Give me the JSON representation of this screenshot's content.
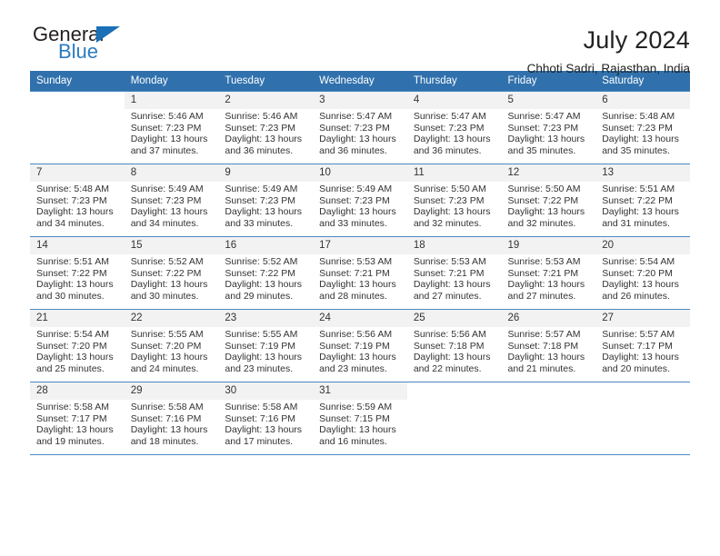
{
  "brand": {
    "name_top": "General",
    "name_bottom": "Blue",
    "triangle_color": "#1b70b8",
    "blue_color": "#2b7cc0"
  },
  "header": {
    "title": "July 2024",
    "location": "Chhoti Sadri, Rajasthan, India"
  },
  "calendar": {
    "header_bg": "#3071ad",
    "weekdays": [
      "Sunday",
      "Monday",
      "Tuesday",
      "Wednesday",
      "Thursday",
      "Friday",
      "Saturday"
    ],
    "labels": {
      "sunrise": "Sunrise:",
      "sunset": "Sunset:",
      "daylight": "Daylight:"
    },
    "weeks": [
      [
        {
          "day": "",
          "sunrise": "",
          "sunset": "",
          "daylight_line1": "",
          "daylight_line2": ""
        },
        {
          "day": "1",
          "sunrise": "Sunrise: 5:46 AM",
          "sunset": "Sunset: 7:23 PM",
          "daylight_line1": "Daylight: 13 hours",
          "daylight_line2": "and 37 minutes."
        },
        {
          "day": "2",
          "sunrise": "Sunrise: 5:46 AM",
          "sunset": "Sunset: 7:23 PM",
          "daylight_line1": "Daylight: 13 hours",
          "daylight_line2": "and 36 minutes."
        },
        {
          "day": "3",
          "sunrise": "Sunrise: 5:47 AM",
          "sunset": "Sunset: 7:23 PM",
          "daylight_line1": "Daylight: 13 hours",
          "daylight_line2": "and 36 minutes."
        },
        {
          "day": "4",
          "sunrise": "Sunrise: 5:47 AM",
          "sunset": "Sunset: 7:23 PM",
          "daylight_line1": "Daylight: 13 hours",
          "daylight_line2": "and 36 minutes."
        },
        {
          "day": "5",
          "sunrise": "Sunrise: 5:47 AM",
          "sunset": "Sunset: 7:23 PM",
          "daylight_line1": "Daylight: 13 hours",
          "daylight_line2": "and 35 minutes."
        },
        {
          "day": "6",
          "sunrise": "Sunrise: 5:48 AM",
          "sunset": "Sunset: 7:23 PM",
          "daylight_line1": "Daylight: 13 hours",
          "daylight_line2": "and 35 minutes."
        }
      ],
      [
        {
          "day": "7",
          "sunrise": "Sunrise: 5:48 AM",
          "sunset": "Sunset: 7:23 PM",
          "daylight_line1": "Daylight: 13 hours",
          "daylight_line2": "and 34 minutes."
        },
        {
          "day": "8",
          "sunrise": "Sunrise: 5:49 AM",
          "sunset": "Sunset: 7:23 PM",
          "daylight_line1": "Daylight: 13 hours",
          "daylight_line2": "and 34 minutes."
        },
        {
          "day": "9",
          "sunrise": "Sunrise: 5:49 AM",
          "sunset": "Sunset: 7:23 PM",
          "daylight_line1": "Daylight: 13 hours",
          "daylight_line2": "and 33 minutes."
        },
        {
          "day": "10",
          "sunrise": "Sunrise: 5:49 AM",
          "sunset": "Sunset: 7:23 PM",
          "daylight_line1": "Daylight: 13 hours",
          "daylight_line2": "and 33 minutes."
        },
        {
          "day": "11",
          "sunrise": "Sunrise: 5:50 AM",
          "sunset": "Sunset: 7:23 PM",
          "daylight_line1": "Daylight: 13 hours",
          "daylight_line2": "and 32 minutes."
        },
        {
          "day": "12",
          "sunrise": "Sunrise: 5:50 AM",
          "sunset": "Sunset: 7:22 PM",
          "daylight_line1": "Daylight: 13 hours",
          "daylight_line2": "and 32 minutes."
        },
        {
          "day": "13",
          "sunrise": "Sunrise: 5:51 AM",
          "sunset": "Sunset: 7:22 PM",
          "daylight_line1": "Daylight: 13 hours",
          "daylight_line2": "and 31 minutes."
        }
      ],
      [
        {
          "day": "14",
          "sunrise": "Sunrise: 5:51 AM",
          "sunset": "Sunset: 7:22 PM",
          "daylight_line1": "Daylight: 13 hours",
          "daylight_line2": "and 30 minutes."
        },
        {
          "day": "15",
          "sunrise": "Sunrise: 5:52 AM",
          "sunset": "Sunset: 7:22 PM",
          "daylight_line1": "Daylight: 13 hours",
          "daylight_line2": "and 30 minutes."
        },
        {
          "day": "16",
          "sunrise": "Sunrise: 5:52 AM",
          "sunset": "Sunset: 7:22 PM",
          "daylight_line1": "Daylight: 13 hours",
          "daylight_line2": "and 29 minutes."
        },
        {
          "day": "17",
          "sunrise": "Sunrise: 5:53 AM",
          "sunset": "Sunset: 7:21 PM",
          "daylight_line1": "Daylight: 13 hours",
          "daylight_line2": "and 28 minutes."
        },
        {
          "day": "18",
          "sunrise": "Sunrise: 5:53 AM",
          "sunset": "Sunset: 7:21 PM",
          "daylight_line1": "Daylight: 13 hours",
          "daylight_line2": "and 27 minutes."
        },
        {
          "day": "19",
          "sunrise": "Sunrise: 5:53 AM",
          "sunset": "Sunset: 7:21 PM",
          "daylight_line1": "Daylight: 13 hours",
          "daylight_line2": "and 27 minutes."
        },
        {
          "day": "20",
          "sunrise": "Sunrise: 5:54 AM",
          "sunset": "Sunset: 7:20 PM",
          "daylight_line1": "Daylight: 13 hours",
          "daylight_line2": "and 26 minutes."
        }
      ],
      [
        {
          "day": "21",
          "sunrise": "Sunrise: 5:54 AM",
          "sunset": "Sunset: 7:20 PM",
          "daylight_line1": "Daylight: 13 hours",
          "daylight_line2": "and 25 minutes."
        },
        {
          "day": "22",
          "sunrise": "Sunrise: 5:55 AM",
          "sunset": "Sunset: 7:20 PM",
          "daylight_line1": "Daylight: 13 hours",
          "daylight_line2": "and 24 minutes."
        },
        {
          "day": "23",
          "sunrise": "Sunrise: 5:55 AM",
          "sunset": "Sunset: 7:19 PM",
          "daylight_line1": "Daylight: 13 hours",
          "daylight_line2": "and 23 minutes."
        },
        {
          "day": "24",
          "sunrise": "Sunrise: 5:56 AM",
          "sunset": "Sunset: 7:19 PM",
          "daylight_line1": "Daylight: 13 hours",
          "daylight_line2": "and 23 minutes."
        },
        {
          "day": "25",
          "sunrise": "Sunrise: 5:56 AM",
          "sunset": "Sunset: 7:18 PM",
          "daylight_line1": "Daylight: 13 hours",
          "daylight_line2": "and 22 minutes."
        },
        {
          "day": "26",
          "sunrise": "Sunrise: 5:57 AM",
          "sunset": "Sunset: 7:18 PM",
          "daylight_line1": "Daylight: 13 hours",
          "daylight_line2": "and 21 minutes."
        },
        {
          "day": "27",
          "sunrise": "Sunrise: 5:57 AM",
          "sunset": "Sunset: 7:17 PM",
          "daylight_line1": "Daylight: 13 hours",
          "daylight_line2": "and 20 minutes."
        }
      ],
      [
        {
          "day": "28",
          "sunrise": "Sunrise: 5:58 AM",
          "sunset": "Sunset: 7:17 PM",
          "daylight_line1": "Daylight: 13 hours",
          "daylight_line2": "and 19 minutes."
        },
        {
          "day": "29",
          "sunrise": "Sunrise: 5:58 AM",
          "sunset": "Sunset: 7:16 PM",
          "daylight_line1": "Daylight: 13 hours",
          "daylight_line2": "and 18 minutes."
        },
        {
          "day": "30",
          "sunrise": "Sunrise: 5:58 AM",
          "sunset": "Sunset: 7:16 PM",
          "daylight_line1": "Daylight: 13 hours",
          "daylight_line2": "and 17 minutes."
        },
        {
          "day": "31",
          "sunrise": "Sunrise: 5:59 AM",
          "sunset": "Sunset: 7:15 PM",
          "daylight_line1": "Daylight: 13 hours",
          "daylight_line2": "and 16 minutes."
        },
        {
          "day": "",
          "sunrise": "",
          "sunset": "",
          "daylight_line1": "",
          "daylight_line2": ""
        },
        {
          "day": "",
          "sunrise": "",
          "sunset": "",
          "daylight_line1": "",
          "daylight_line2": ""
        },
        {
          "day": "",
          "sunrise": "",
          "sunset": "",
          "daylight_line1": "",
          "daylight_line2": ""
        }
      ]
    ]
  }
}
